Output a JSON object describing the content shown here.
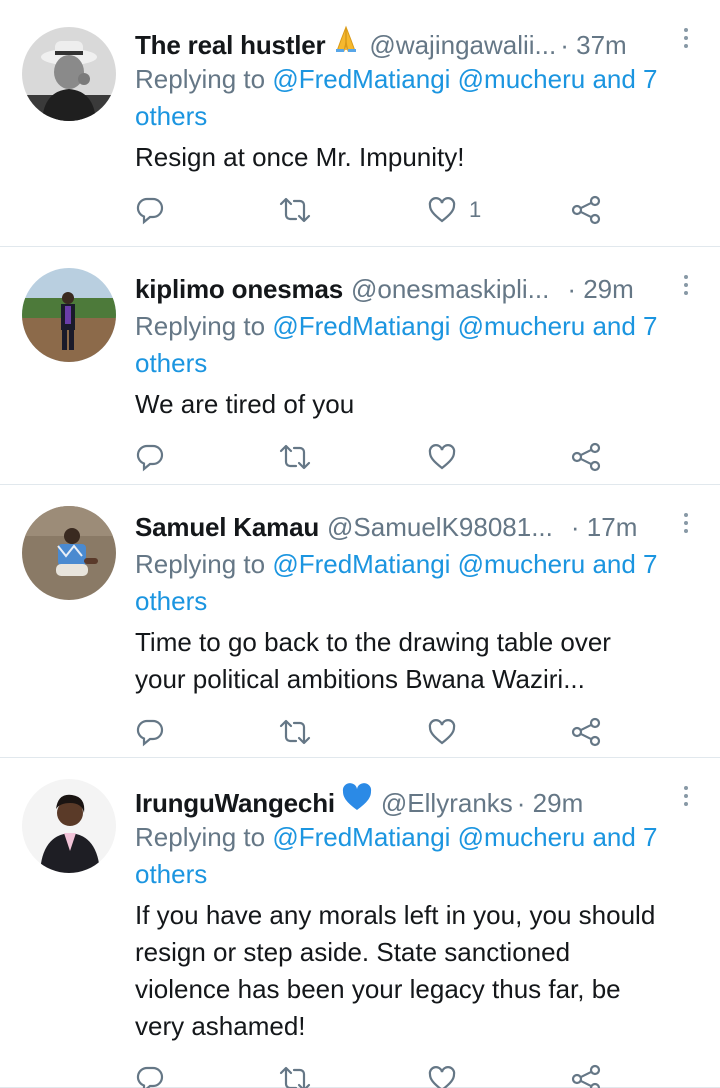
{
  "colors": {
    "link": "#1b95e0",
    "muted": "#657786",
    "text": "#14171a",
    "divider": "#e1e8ed"
  },
  "tweets": [
    {
      "name": "The real hustler",
      "badge": "folded-hands-emoji",
      "handle": "@wajingawalii...",
      "time": "· 37m",
      "reply_prefix": "Replying to",
      "reply_mentions": "@FredMatiangi @mucheru and 7 others",
      "text_lines": [
        "Resign at once Mr. Impunity!"
      ],
      "like_count": "1"
    },
    {
      "name": "kiplimo onesmas",
      "badge": "",
      "handle": "@onesmaskipli...",
      "time": "· 29m",
      "reply_prefix": "Replying to",
      "reply_mentions": "@FredMatiangi @mucheru and 7 others",
      "text_lines": [
        "We are tired of you"
      ],
      "like_count": ""
    },
    {
      "name": "Samuel Kamau",
      "badge": "",
      "handle": "@SamuelK98081...",
      "time": "· 17m",
      "reply_prefix": "Replying to",
      "reply_mentions": "@FredMatiangi @mucheru and 7 others",
      "text_lines": [
        "Time to go back to the drawing table over",
        "your political ambitions Bwana Waziri..."
      ],
      "like_count": ""
    },
    {
      "name": "IrunguWangechi",
      "badge": "blue-heart-emoji",
      "handle": "@Ellyranks",
      "time": "· 29m",
      "reply_prefix": "Replying to",
      "reply_mentions": "@FredMatiangi @mucheru and 7 others",
      "text_lines": [
        "If you have any morals left in you, you should",
        "resign or step aside. State sanctioned",
        "violence has been your legacy thus far, be",
        "very ashamed!"
      ],
      "like_count": ""
    }
  ]
}
